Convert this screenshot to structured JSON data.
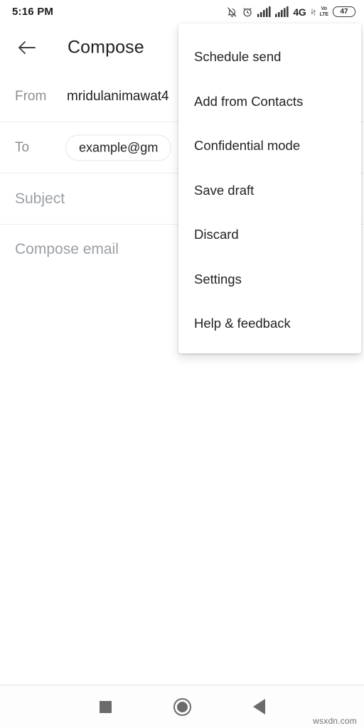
{
  "status_bar": {
    "clock": "5:16 PM",
    "icons": [
      {
        "name": "notifications-off-icon",
        "label": ""
      },
      {
        "name": "alarm-clock-icon",
        "label": ""
      },
      {
        "name": "signal-bars-sim1-icon",
        "label": ""
      },
      {
        "name": "signal-bars-sim2-icon",
        "label": ""
      }
    ],
    "network_label": "4G",
    "volte_top": "Vo",
    "volte_bottom": "LTE",
    "battery_level": "47"
  },
  "app_bar": {
    "back_icon": "arrow-left-icon",
    "title": "Compose"
  },
  "compose": {
    "from_label": "From",
    "from_value": "mridulanimawat4",
    "to_label": "To",
    "to_chip": "example@gm",
    "subject_placeholder": "Subject",
    "body_placeholder": "Compose email"
  },
  "overflow_menu": {
    "items": [
      {
        "label": "Schedule send",
        "name": "menu-item-schedule-send"
      },
      {
        "label": "Add from Contacts",
        "name": "menu-item-add-from-contacts"
      },
      {
        "label": "Confidential mode",
        "name": "menu-item-confidential-mode"
      },
      {
        "label": "Save draft",
        "name": "menu-item-save-draft"
      },
      {
        "label": "Discard",
        "name": "menu-item-discard"
      },
      {
        "label": "Settings",
        "name": "menu-item-settings"
      },
      {
        "label": "Help & feedback",
        "name": "menu-item-help-feedback"
      }
    ]
  },
  "nav_bar": {
    "recents_icon": "square-recents-icon",
    "home_icon": "circle-home-icon",
    "back_icon": "triangle-back-icon"
  },
  "watermark": "wsxdn.com",
  "colors": {
    "background": "#ffffff",
    "text_primary": "#202124",
    "text_secondary": "#8a8d91",
    "placeholder": "#9aa0a6",
    "divider": "#eceded",
    "nav_icon": "#6b6b6b",
    "menu_text": "#232323"
  }
}
